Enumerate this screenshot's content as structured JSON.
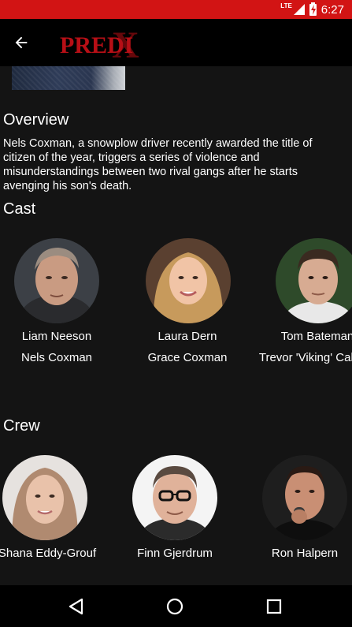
{
  "status_bar": {
    "network": "LTE",
    "battery_level": "6",
    "time": "6:27",
    "background_color": "#d21414"
  },
  "app_bar": {
    "back_icon": "arrow-left-icon",
    "logo_text": "PREDI",
    "logo_overlay": "X",
    "logo_color": "#b70f16"
  },
  "overview": {
    "title": "Overview",
    "text": "Nels Coxman, a snowplow driver recently awarded the title of citizen of the year, triggers a series of violence and misunderstandings between two rival gangs after he starts avenging his son's death."
  },
  "cast": {
    "title": "Cast",
    "people": [
      {
        "name": "Liam Neeson",
        "role": "Nels Coxman"
      },
      {
        "name": "Laura Dern",
        "role": "Grace Coxman"
      },
      {
        "name": "Tom Bateman",
        "role": "Trevor 'Viking' Calcote"
      }
    ]
  },
  "crew": {
    "title": "Crew",
    "people": [
      {
        "name": "Shana Eddy-Grouf"
      },
      {
        "name": "Finn Gjerdrum"
      },
      {
        "name": "Ron Halpern"
      }
    ]
  },
  "nav_bar": {
    "back_icon": "triangle-back-icon",
    "home_icon": "circle-home-icon",
    "recents_icon": "square-recents-icon"
  }
}
